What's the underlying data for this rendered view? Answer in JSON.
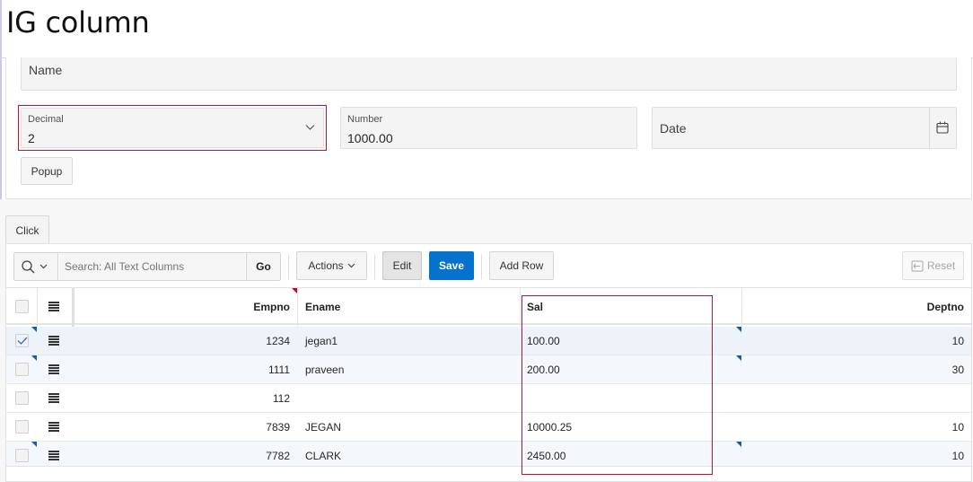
{
  "page": {
    "title": "IG column"
  },
  "form": {
    "name_label": "Name",
    "decimal": {
      "label": "Decimal",
      "value": "2"
    },
    "number": {
      "label": "Number",
      "value": "1000.00"
    },
    "date": {
      "label": "Date"
    },
    "popup_button": "Popup"
  },
  "region_button": "Click",
  "toolbar": {
    "search_placeholder": "Search: All Text Columns",
    "go": "Go",
    "actions": "Actions",
    "edit": "Edit",
    "save": "Save",
    "add_row": "Add Row",
    "reset": "Reset"
  },
  "grid": {
    "columns": [
      "Empno",
      "Ename",
      "Sal",
      "Deptno"
    ],
    "rows": [
      {
        "empno": "1234",
        "ename": "jegan1",
        "sal": "100.00",
        "deptno": "10",
        "checked": true
      },
      {
        "empno": "1111",
        "ename": "praveen",
        "sal": "200.00",
        "deptno": "30",
        "checked": false
      },
      {
        "empno": "112",
        "ename": "",
        "sal": "",
        "deptno": "",
        "checked": false
      },
      {
        "empno": "7839",
        "ename": "JEGAN",
        "sal": "10000.25",
        "deptno": "10",
        "checked": false
      },
      {
        "empno": "7782",
        "ename": "CLARK",
        "sal": "2450.00",
        "deptno": "10",
        "checked": false
      }
    ]
  },
  "colors": {
    "accent": "#0572ce",
    "highlight": "#c8102e",
    "selected_row": "#eef3f9"
  }
}
